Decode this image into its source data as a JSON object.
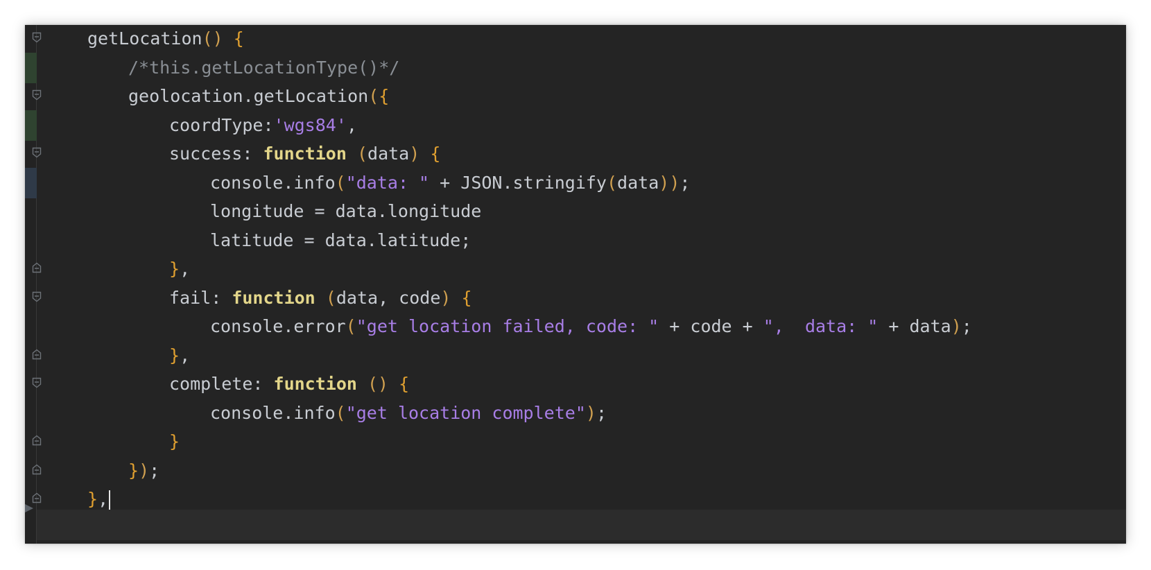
{
  "editor": {
    "colors": {
      "background": "#242424",
      "default_text": "#c9cdd3",
      "comment": "#8a8f95",
      "keyword": "#e3d68a",
      "string": "#a87ee6",
      "paren": "#d0a050",
      "brace": "#e0a030",
      "change_added": "#2f4330",
      "change_modified": "#2f3a48"
    },
    "icons": {
      "fold": "fold-marker-icon",
      "arrow": "breakpoint-arrow-icon"
    },
    "lines": [
      {
        "indent": 0,
        "tokens": [
          {
            "t": "getLocation",
            "k": "default"
          },
          {
            "t": "()",
            "k": "paren"
          },
          {
            "t": " ",
            "k": "default"
          },
          {
            "t": "{",
            "k": "brace"
          }
        ]
      },
      {
        "indent": 1,
        "tokens": [
          {
            "t": "/*this.getLocationType()*/",
            "k": "comment"
          }
        ]
      },
      {
        "indent": 1,
        "tokens": [
          {
            "t": "geolocation.getLocation",
            "k": "default"
          },
          {
            "t": "(",
            "k": "paren"
          },
          {
            "t": "{",
            "k": "brace"
          }
        ]
      },
      {
        "indent": 2,
        "tokens": [
          {
            "t": "coordType:",
            "k": "default"
          },
          {
            "t": "'wgs84'",
            "k": "string"
          },
          {
            "t": ",",
            "k": "punct"
          }
        ]
      },
      {
        "indent": 2,
        "tokens": [
          {
            "t": "success: ",
            "k": "default"
          },
          {
            "t": "function",
            "k": "keyword"
          },
          {
            "t": " ",
            "k": "default"
          },
          {
            "t": "(",
            "k": "paren"
          },
          {
            "t": "data",
            "k": "default"
          },
          {
            "t": ")",
            "k": "paren"
          },
          {
            "t": " ",
            "k": "default"
          },
          {
            "t": "{",
            "k": "brace"
          }
        ]
      },
      {
        "indent": 3,
        "tokens": [
          {
            "t": "console.info",
            "k": "default"
          },
          {
            "t": "(",
            "k": "paren"
          },
          {
            "t": "\"data: \"",
            "k": "string"
          },
          {
            "t": " + JSON.stringify",
            "k": "default"
          },
          {
            "t": "(",
            "k": "paren"
          },
          {
            "t": "data",
            "k": "default"
          },
          {
            "t": "))",
            "k": "paren"
          },
          {
            "t": ";",
            "k": "punct"
          }
        ]
      },
      {
        "indent": 3,
        "tokens": [
          {
            "t": "longitude = data.longitude",
            "k": "default"
          }
        ]
      },
      {
        "indent": 3,
        "tokens": [
          {
            "t": "latitude = data.latitude;",
            "k": "default"
          }
        ]
      },
      {
        "indent": 2,
        "tokens": [
          {
            "t": "}",
            "k": "brace"
          },
          {
            "t": ",",
            "k": "punct"
          }
        ]
      },
      {
        "indent": 2,
        "tokens": [
          {
            "t": "fail: ",
            "k": "default"
          },
          {
            "t": "function",
            "k": "keyword"
          },
          {
            "t": " ",
            "k": "default"
          },
          {
            "t": "(",
            "k": "paren"
          },
          {
            "t": "data, code",
            "k": "default"
          },
          {
            "t": ")",
            "k": "paren"
          },
          {
            "t": " ",
            "k": "default"
          },
          {
            "t": "{",
            "k": "brace"
          }
        ]
      },
      {
        "indent": 3,
        "tokens": [
          {
            "t": "console.error",
            "k": "default"
          },
          {
            "t": "(",
            "k": "paren"
          },
          {
            "t": "\"get location failed, code: \"",
            "k": "string"
          },
          {
            "t": " + code + ",
            "k": "default"
          },
          {
            "t": "\",  data: \"",
            "k": "string"
          },
          {
            "t": " + data",
            "k": "default"
          },
          {
            "t": ")",
            "k": "paren"
          },
          {
            "t": ";",
            "k": "punct"
          }
        ]
      },
      {
        "indent": 2,
        "tokens": [
          {
            "t": "}",
            "k": "brace"
          },
          {
            "t": ",",
            "k": "punct"
          }
        ]
      },
      {
        "indent": 2,
        "tokens": [
          {
            "t": "complete: ",
            "k": "default"
          },
          {
            "t": "function",
            "k": "keyword"
          },
          {
            "t": " ",
            "k": "default"
          },
          {
            "t": "()",
            "k": "paren"
          },
          {
            "t": " ",
            "k": "default"
          },
          {
            "t": "{",
            "k": "brace"
          }
        ]
      },
      {
        "indent": 3,
        "tokens": [
          {
            "t": "console.info",
            "k": "default"
          },
          {
            "t": "(",
            "k": "paren"
          },
          {
            "t": "\"get location complete\"",
            "k": "string"
          },
          {
            "t": ")",
            "k": "paren"
          },
          {
            "t": ";",
            "k": "punct"
          }
        ]
      },
      {
        "indent": 2,
        "tokens": [
          {
            "t": "}",
            "k": "brace"
          }
        ]
      },
      {
        "indent": 1,
        "tokens": [
          {
            "t": "}",
            "k": "brace"
          },
          {
            "t": ")",
            "k": "paren"
          },
          {
            "t": ";",
            "k": "punct"
          }
        ]
      },
      {
        "indent": 0,
        "caret": true,
        "tokens": [
          {
            "t": "}",
            "k": "brace"
          },
          {
            "t": ",",
            "k": "punct"
          }
        ]
      }
    ]
  }
}
